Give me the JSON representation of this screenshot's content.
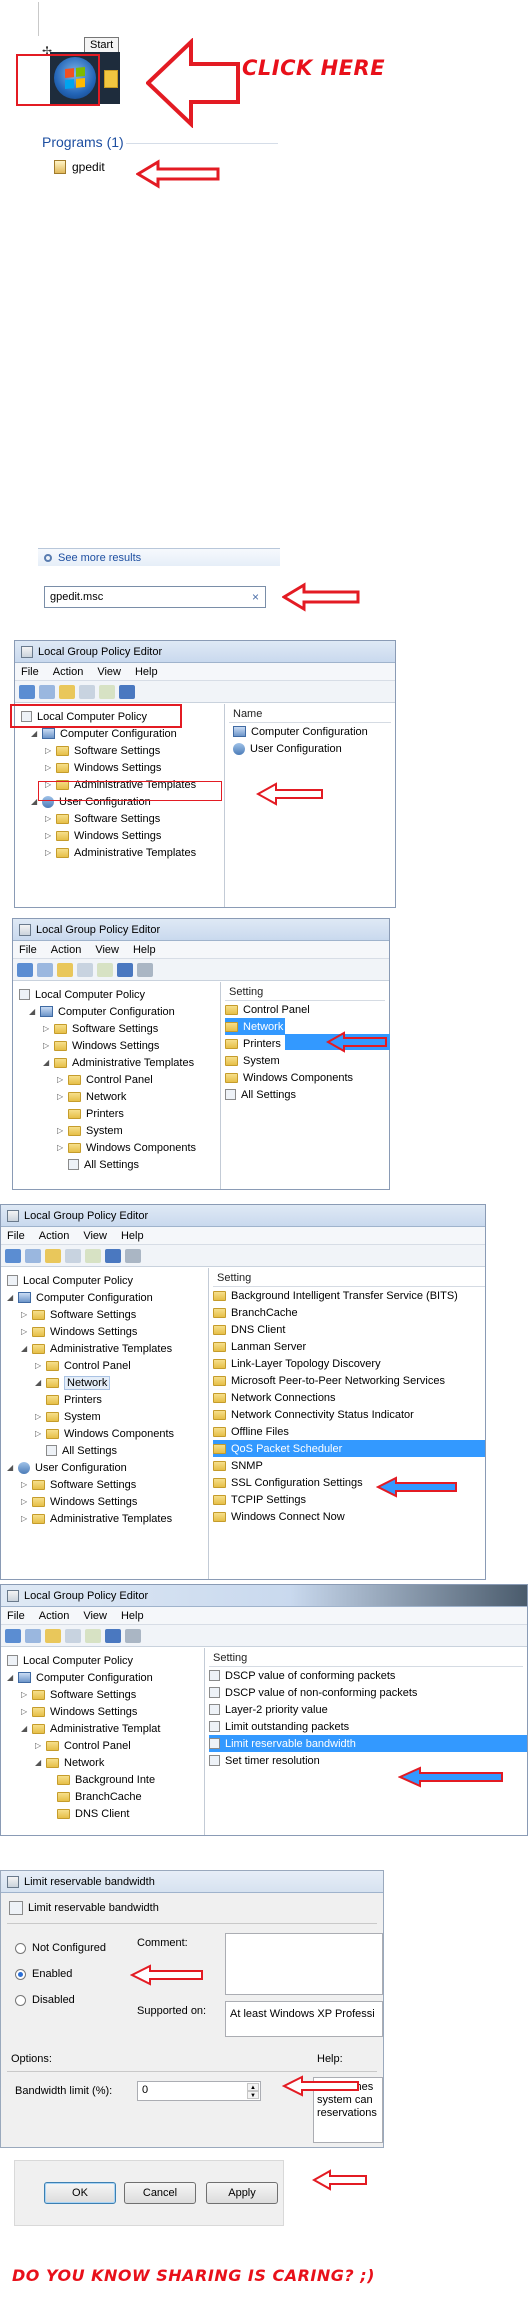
{
  "start_button": {
    "tooltip": "Start"
  },
  "annotations": {
    "click_here": "CLICK HERE",
    "footer": "DO YOU KNOW SHARING IS CARING? ;)"
  },
  "search_results": {
    "group_header": "Programs (1)",
    "item": "gpedit",
    "see_more": "See more results",
    "search_value": "gpedit.msc",
    "clear_glyph": "×"
  },
  "window1": {
    "title": "Local Group Policy Editor",
    "menu": [
      "File",
      "Action",
      "View",
      "Help"
    ],
    "tree": {
      "root": "Local Computer Policy",
      "computer_config": "Computer Configuration",
      "software_settings": "Software Settings",
      "windows_settings": "Windows Settings",
      "admin_templates": "Administrative Templates",
      "user_config": "User Configuration",
      "u_software_settings": "Software Settings",
      "u_windows_settings": "Windows Settings",
      "u_admin_templates": "Administrative Templates"
    },
    "list_header": "Name",
    "list": [
      "Computer Configuration",
      "User Configuration"
    ]
  },
  "window2": {
    "title": "Local Group Policy Editor",
    "menu": [
      "File",
      "Action",
      "View",
      "Help"
    ],
    "tree": [
      "Local Computer Policy",
      "Computer Configuration",
      "Software Settings",
      "Windows Settings",
      "Administrative Templates",
      "Control Panel",
      "Network",
      "Printers",
      "System",
      "Windows Components",
      "All Settings"
    ],
    "list_header": "Setting",
    "list": [
      "Control Panel",
      "Network",
      "Printers",
      "System",
      "Windows Components",
      "All Settings"
    ],
    "selected": "Network"
  },
  "window3": {
    "title": "Local Group Policy Editor",
    "menu": [
      "File",
      "Action",
      "View",
      "Help"
    ],
    "tree": [
      "Local Computer Policy",
      "Computer Configuration",
      "Software Settings",
      "Windows Settings",
      "Administrative Templates",
      "Control Panel",
      "Network",
      "Printers",
      "System",
      "Windows Components",
      "All Settings",
      "User Configuration",
      "Software Settings",
      "Windows Settings",
      "Administrative Templates"
    ],
    "list_header": "Setting",
    "list": [
      "Background Intelligent Transfer Service (BITS)",
      "BranchCache",
      "DNS Client",
      "Lanman Server",
      "Link-Layer Topology Discovery",
      "Microsoft Peer-to-Peer Networking Services",
      "Network Connections",
      "Network Connectivity Status Indicator",
      "Offline Files",
      "QoS Packet Scheduler",
      "SNMP",
      "SSL Configuration Settings",
      "TCPIP Settings",
      "Windows Connect Now"
    ],
    "selected": "QoS Packet Scheduler"
  },
  "window4": {
    "title": "Local Group Policy Editor",
    "menu": [
      "File",
      "Action",
      "View",
      "Help"
    ],
    "tree": [
      "Local Computer Policy",
      "Computer Configuration",
      "Software Settings",
      "Windows Settings",
      "Administrative Templat",
      "Control Panel",
      "Network",
      "Background Inte",
      "BranchCache",
      "DNS Client"
    ],
    "list_header": "Setting",
    "list": [
      "DSCP value of conforming packets",
      "DSCP value of non-conforming packets",
      "Layer-2 priority value",
      "Limit outstanding packets",
      "Limit reservable bandwidth",
      "Set timer resolution"
    ],
    "selected": "Limit reservable bandwidth"
  },
  "dialog": {
    "title": "Limit reservable bandwidth",
    "heading": "Limit reservable bandwidth",
    "radios": [
      "Not Configured",
      "Enabled",
      "Disabled"
    ],
    "selected_radio": "Enabled",
    "comment_label": "Comment:",
    "supported_label": "Supported on:",
    "supported_value": "At least Windows XP Professi",
    "options_label": "Options:",
    "help_label": "Help:",
    "bandwidth_label": "Bandwidth limit (%):",
    "bandwidth_value": "0",
    "help_text": [
      "Determines",
      "system can",
      "reservations"
    ],
    "ok": "OK",
    "cancel": "Cancel",
    "apply": "Apply"
  },
  "colors": {
    "accent_red": "#e31b23",
    "selection_blue": "#3399ff"
  }
}
